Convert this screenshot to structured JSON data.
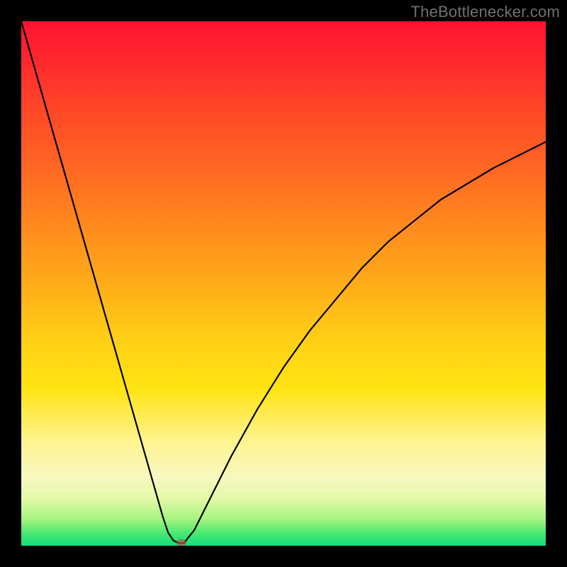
{
  "watermark": "TheBottlenecker.com",
  "chart_data": {
    "type": "line",
    "title": "",
    "xlabel": "",
    "ylabel": "",
    "xlim": [
      0,
      100
    ],
    "ylim": [
      0,
      100
    ],
    "curve": {
      "x": [
        0,
        2,
        4,
        6,
        8,
        10,
        12,
        14,
        16,
        18,
        20,
        22,
        24,
        26,
        27,
        28,
        29,
        30,
        31,
        33,
        36,
        40,
        45,
        50,
        55,
        60,
        65,
        70,
        75,
        80,
        85,
        90,
        95,
        100
      ],
      "y": [
        100,
        93,
        86,
        79,
        72,
        65,
        58,
        51,
        44,
        37,
        30,
        23,
        16,
        9,
        5.5,
        2.5,
        1.0,
        0.5,
        0.5,
        3,
        9,
        17,
        26,
        34,
        41,
        47,
        53,
        58,
        62,
        66,
        69,
        72,
        74.5,
        77
      ]
    },
    "marker": {
      "x": 30.5,
      "y": 0.5,
      "color": "#c0504a"
    },
    "gradient_stops": [
      {
        "pct": 0,
        "color": "#ff1330"
      },
      {
        "pct": 50,
        "color": "#ffb218"
      },
      {
        "pct": 100,
        "color": "#14dc7d"
      }
    ]
  }
}
